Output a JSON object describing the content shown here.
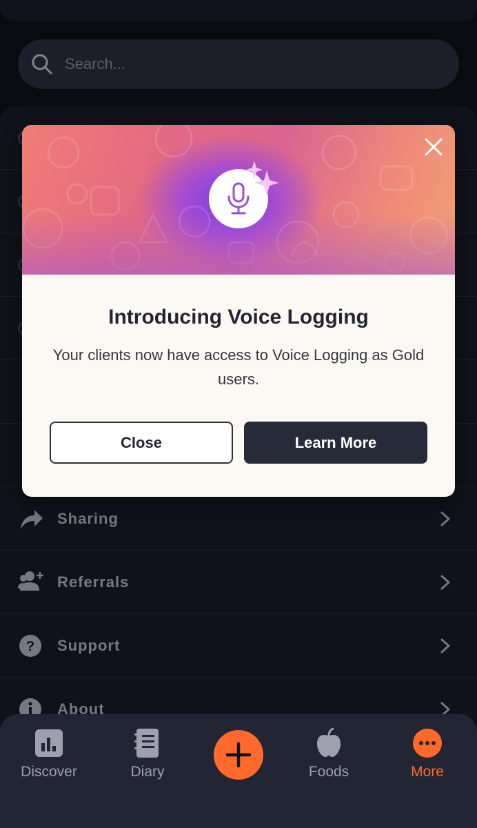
{
  "search": {
    "placeholder": "Search..."
  },
  "menu": {
    "items": [
      {
        "label": "Sharing",
        "icon": "share-arrow-icon"
      },
      {
        "label": "Referrals",
        "icon": "add-user-icon"
      },
      {
        "label": "Support",
        "icon": "question-icon"
      },
      {
        "label": "About",
        "icon": "info-icon"
      }
    ]
  },
  "modal": {
    "title": "Introducing Voice Logging",
    "body": "Your clients now have access to Voice Logging as Gold users.",
    "close_label": "Close",
    "learn_more_label": "Learn More",
    "icon": "microphone-icon"
  },
  "nav": {
    "items": [
      {
        "label": "Discover",
        "icon": "bar-chart-icon",
        "active": false
      },
      {
        "label": "Diary",
        "icon": "notebook-icon",
        "active": false
      },
      {
        "label": "Foods",
        "icon": "apple-icon",
        "active": false
      },
      {
        "label": "More",
        "icon": "more-dots-icon",
        "active": true
      }
    ],
    "add_icon": "plus-icon"
  },
  "colors": {
    "accent": "#ff6a2c",
    "background": "#0b0e15",
    "modal_bg": "#fcf9f4",
    "primary_button": "#272a39"
  }
}
